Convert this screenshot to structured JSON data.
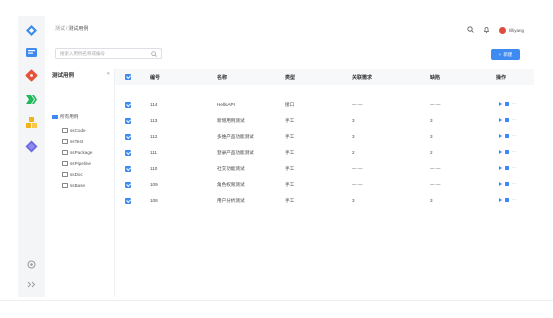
{
  "breadcrumb": {
    "root": "测试",
    "separator": "/",
    "current": "测试用例"
  },
  "header": {
    "user_name": "lilliyang",
    "icons": [
      "search-icon",
      "bell-icon"
    ]
  },
  "toolbar": {
    "search_placeholder": "搜索入用例名称或编号",
    "new_button_label": "新建"
  },
  "tree": {
    "title": "测试用例",
    "collapse_icon": "chevron-left-icon",
    "root_label": "所有用例",
    "children": [
      "ssCode",
      "ssTest",
      "ssPackage",
      "ssPipeline",
      "ssDoc",
      "ssBase"
    ]
  },
  "table": {
    "columns": [
      "编号",
      "名称",
      "类型",
      "关联需求",
      "缺陷",
      "操作"
    ],
    "rows": [
      {
        "id": "114",
        "name": "HelloAPI",
        "type": "接口",
        "req": "— —",
        "bug": "— —"
      },
      {
        "id": "113",
        "name": "新增用例测试",
        "type": "手工",
        "req": "3",
        "bug": "3"
      },
      {
        "id": "112",
        "name": "多维产品功能测试",
        "type": "手工",
        "req": "3",
        "bug": "3"
      },
      {
        "id": "111",
        "name": "登录产品功能测试",
        "type": "手工",
        "req": "2",
        "bug": "2"
      },
      {
        "id": "110",
        "name": "社交功能测试",
        "type": "手工",
        "req": "— —",
        "bug": "— —"
      },
      {
        "id": "109",
        "name": "角色权限测试",
        "type": "手工",
        "req": "— —",
        "bug": "— —"
      },
      {
        "id": "108",
        "name": "用户分析测试",
        "type": "手工",
        "req": "3",
        "bug": "3"
      }
    ]
  },
  "rail": {
    "icons": [
      "logo-icon",
      "code-app-icon",
      "git-icon",
      "pipeline-icon",
      "blocks-icon",
      "diamond-icon",
      "settings-icon",
      "expand-icon"
    ]
  }
}
